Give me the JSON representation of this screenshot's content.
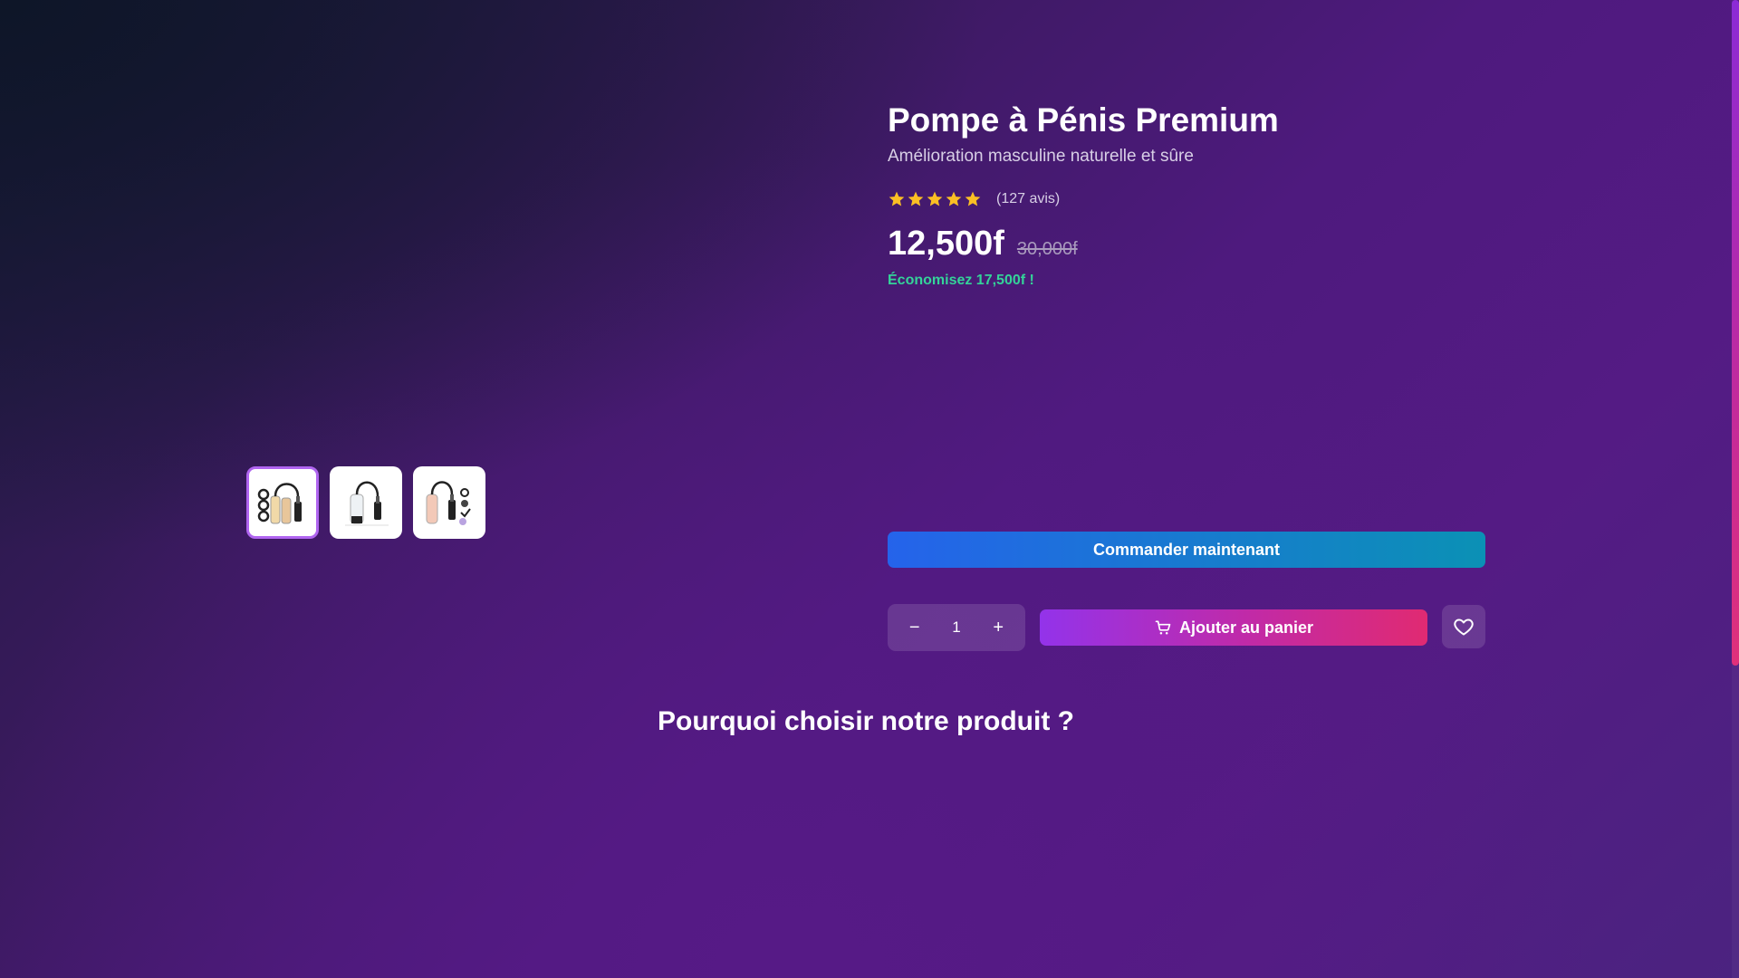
{
  "product": {
    "title": "Pompe à Pénis Premium",
    "subtitle": "Amélioration masculine naturelle et sûre",
    "rating": {
      "stars": 5,
      "reviews_label": "(127 avis)"
    },
    "price": "12,500f",
    "old_price": "30,000f",
    "savings": "Économisez 17,500f !"
  },
  "gallery": {
    "thumbnails": [
      "thumbnail-1",
      "thumbnail-2",
      "thumbnail-3"
    ],
    "active_index": 0
  },
  "actions": {
    "order_label": "Commander maintenant",
    "quantity": "1",
    "decrement_symbol": "−",
    "increment_symbol": "+",
    "cart_label": "Ajouter au panier",
    "cart_icon": "cart-icon",
    "wishlist_icon": "heart-icon"
  },
  "section": {
    "why_title": "Pourquoi choisir notre produit ?"
  },
  "colors": {
    "star": "#fbbf24",
    "savings": "#34d399",
    "order_gradient": [
      "#2563eb",
      "#0b91b5"
    ],
    "cart_gradient": [
      "#9333ea",
      "#e02a72"
    ],
    "active_thumb_border": "#b065f0"
  }
}
